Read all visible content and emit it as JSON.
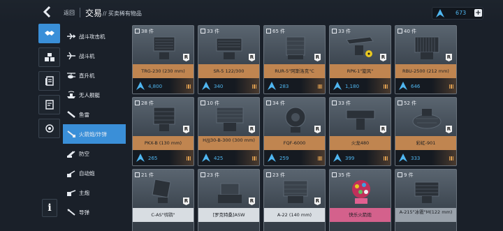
{
  "header": {
    "back_label": "返回",
    "title": "交易",
    "subtitle": "// 买卖稀有物品",
    "currency_value": "673",
    "currency_plus": "+"
  },
  "icon_column": [
    {
      "name": "handshake-icon",
      "active": true
    },
    {
      "name": "crates-icon",
      "active": false
    },
    {
      "name": "documents-icon",
      "active": false
    },
    {
      "name": "quest-icon",
      "active": false
    },
    {
      "name": "refresh-icon",
      "active": false
    }
  ],
  "categories": [
    {
      "label": "战斗攻击机",
      "icon": "attack-jet-icon",
      "active": false
    },
    {
      "label": "战斗机",
      "icon": "fighter-jet-icon",
      "active": false
    },
    {
      "label": "直升机",
      "icon": "helicopter-icon",
      "active": false
    },
    {
      "label": "无人舰艇",
      "icon": "drone-boat-icon",
      "active": false
    },
    {
      "label": "鱼雷",
      "icon": "torpedo-icon",
      "active": false
    },
    {
      "label": "火箭炮/炸弹",
      "icon": "rocket-launcher-icon",
      "active": true
    },
    {
      "label": "防空",
      "icon": "anti-air-icon",
      "active": false
    },
    {
      "label": "自动炮",
      "icon": "autocannon-icon",
      "active": false
    },
    {
      "label": "主炮",
      "icon": "main-gun-icon",
      "active": false
    },
    {
      "label": "导弹",
      "icon": "missile-icon",
      "active": false
    }
  ],
  "info_label": "i",
  "cards": [
    {
      "qty": "38 件",
      "name": "TRG-230 (230 mm)",
      "price": "4,800",
      "band": "orange",
      "badge": "R"
    },
    {
      "qty": "33 件",
      "name": "SR-5 122/300",
      "price": "340",
      "band": "orange",
      "badge": "R"
    },
    {
      "qty": "65 件",
      "name": "RUR-5\"阿斯洛克\"C",
      "price": "283",
      "band": "orange",
      "badge": "R"
    },
    {
      "qty": "33 件",
      "name": "RPK-1\"旋风\"",
      "price": "1,180",
      "band": "orange",
      "badge": "R"
    },
    {
      "qty": "40 件",
      "name": "RBU-2500 (212 mm)",
      "price": "646",
      "band": "orange",
      "badge": "R"
    },
    {
      "qty": "28 件",
      "name": "PKX-B (130 mm)",
      "price": "265",
      "band": "orange",
      "badge": "R"
    },
    {
      "qty": "10 件",
      "name": "H/JJ30-B-300 (300 mm)",
      "price": "425",
      "band": "orange",
      "badge": "R"
    },
    {
      "qty": "34 件",
      "name": "FQF-6000",
      "price": "259",
      "band": "orange",
      "badge": "R"
    },
    {
      "qty": "33 件",
      "name": "火龙480",
      "price": "399",
      "band": "orange",
      "badge": "R"
    },
    {
      "qty": "52 件",
      "name": "彩虹-901",
      "price": "333",
      "band": "orange",
      "badge": "R"
    },
    {
      "qty": "21 件",
      "name": "C-AS\"鸮鹗\"",
      "price": "",
      "band": "white",
      "badge": "R"
    },
    {
      "qty": "23 件",
      "name": "[罗克特桑]ASW",
      "price": "",
      "band": "white",
      "badge": "R"
    },
    {
      "qty": "23 件",
      "name": "A-22 (140 mm)",
      "price": "",
      "band": "white",
      "badge": "R"
    },
    {
      "qty": "35 件",
      "name": "快乐火箭炮",
      "price": "",
      "band": "magenta",
      "badge": ""
    },
    {
      "qty": "9 件",
      "name": "A-215\"冰雹\"M(122 mm)",
      "price": "",
      "band": "grey",
      "badge": ""
    }
  ],
  "colors": {
    "accent": "#3a8fd8",
    "currency": "#4fb6f0",
    "band_orange": "#c08550",
    "band_magenta": "#d4618c"
  }
}
